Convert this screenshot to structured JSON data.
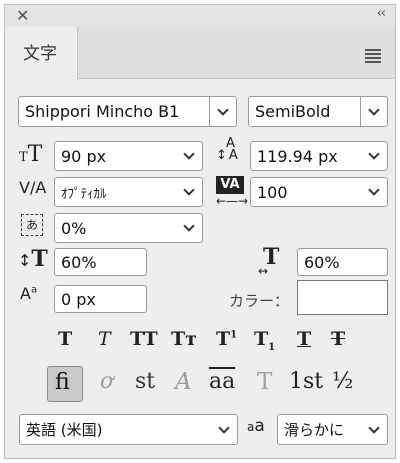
{
  "panel": {
    "tab_label": "文字"
  },
  "font": {
    "family": "Shippori Mincho B1",
    "style": "SemiBold"
  },
  "metrics": {
    "font_size": "90 px",
    "leading": "119.94 px",
    "kerning": "ｵﾌﾟﾃｨｶﾙ",
    "tracking": "100",
    "tsume": "0%",
    "vertical_scale": "60%",
    "horizontal_scale": "60%",
    "baseline_shift": "0 px"
  },
  "color": {
    "label": "カラー：",
    "value": "#ffffff"
  },
  "language": {
    "value": "英語 (米国)"
  },
  "antialias": {
    "icon_text": "a",
    "icon_sub": "a",
    "value": "滑らかに"
  },
  "style_buttons": {
    "faux_bold": "T",
    "faux_italic": "T",
    "all_caps": "TT",
    "small_caps": "Tт",
    "superscript": "T",
    "superscript_mark": "1",
    "subscript": "T",
    "subscript_mark": "1",
    "underline": "T",
    "strikethrough": "T"
  },
  "opentype_buttons": {
    "ligatures": "fi",
    "old_style": "ơ",
    "discretionary": "st",
    "swash": "A",
    "stylistic": "aa",
    "titling": "T",
    "ordinals": "1st",
    "fractions": "½"
  },
  "icons": {
    "close": "close-icon",
    "collapse": "collapse-icon",
    "menu": "panel-menu-icon"
  }
}
